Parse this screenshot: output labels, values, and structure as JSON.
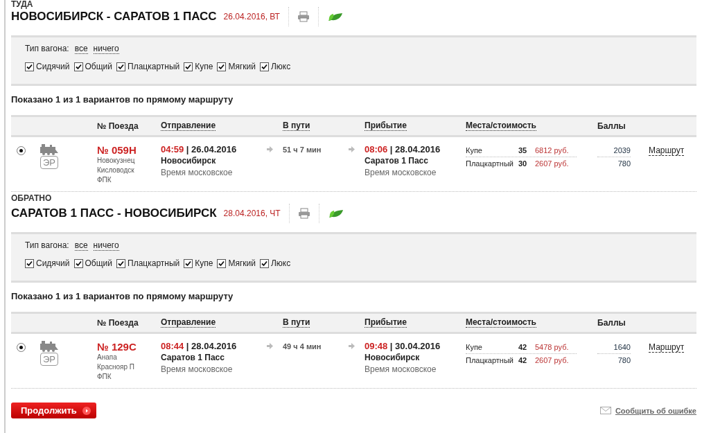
{
  "sections": [
    {
      "direction": "ТУДА",
      "route": "НОВОСИБИРСК - САРАТОВ 1 ПАСС",
      "date": "26.04.2016, ВТ",
      "filter": {
        "label": "Тип вагона:",
        "links": [
          "все",
          "ничего"
        ],
        "types": [
          {
            "label": "Сидячий",
            "checked": true
          },
          {
            "label": "Общий",
            "checked": true
          },
          {
            "label": "Плацкартный",
            "checked": true
          },
          {
            "label": "Купе",
            "checked": true
          },
          {
            "label": "Мягкий",
            "checked": true
          },
          {
            "label": "Люкс",
            "checked": true
          }
        ]
      },
      "summary": "Показано 1 из 1 вариантов по прямому маршруту",
      "columns": [
        {
          "label": "№ Поезда",
          "sortable": false
        },
        {
          "label": "Отправление",
          "sortable": true
        },
        {
          "label": "В пути",
          "sortable": true
        },
        {
          "label": "Прибытие",
          "sortable": true
        },
        {
          "label": "Места/стоимость",
          "sortable": true
        },
        {
          "label": "Баллы",
          "sortable": false
        }
      ],
      "trains": [
        {
          "selected": true,
          "badge": "ЭР",
          "number": "№ 059Н",
          "details": [
            "Новокузнец",
            "Кисловодск",
            "ФПК"
          ],
          "departure": {
            "time": "04:59",
            "date": "| 26.04.2016",
            "station": "Новосибирск",
            "note": "Время московское"
          },
          "duration": "51 ч 7 мин",
          "arrival": {
            "time": "08:06",
            "date": "| 28.04.2016",
            "station": "Саратов 1 Пасс",
            "note": "Время московское"
          },
          "seats": [
            {
              "type": "Купе",
              "count": "35",
              "price": "6812 руб.",
              "points": "2039"
            },
            {
              "type": "Плацкартный",
              "count": "30",
              "price": "2607 руб.",
              "points": "780"
            }
          ],
          "route_link": "Маршрут"
        }
      ]
    },
    {
      "direction": "ОБРАТНО",
      "route": "САРАТОВ 1 ПАСС - НОВОСИБИРСК",
      "date": "28.04.2016, ЧТ",
      "filter": {
        "label": "Тип вагона:",
        "links": [
          "все",
          "ничего"
        ],
        "types": [
          {
            "label": "Сидячий",
            "checked": true
          },
          {
            "label": "Общий",
            "checked": true
          },
          {
            "label": "Плацкартный",
            "checked": true
          },
          {
            "label": "Купе",
            "checked": true
          },
          {
            "label": "Мягкий",
            "checked": true
          },
          {
            "label": "Люкс",
            "checked": true
          }
        ]
      },
      "summary": "Показано 1 из 1 вариантов по прямому маршруту",
      "columns": [
        {
          "label": "№ Поезда",
          "sortable": false
        },
        {
          "label": "Отправление",
          "sortable": true
        },
        {
          "label": "В пути",
          "sortable": true
        },
        {
          "label": "Прибытие",
          "sortable": true
        },
        {
          "label": "Места/стоимость",
          "sortable": true
        },
        {
          "label": "Баллы",
          "sortable": false
        }
      ],
      "trains": [
        {
          "selected": true,
          "badge": "ЭР",
          "number": "№ 129С",
          "details": [
            "Анапа",
            "Краснояр П",
            "ФПК"
          ],
          "departure": {
            "time": "08:44",
            "date": "| 28.04.2016",
            "station": "Саратов 1 Пасс",
            "note": "Время московское"
          },
          "duration": "49 ч 4 мин",
          "arrival": {
            "time": "09:48",
            "date": "| 30.04.2016",
            "station": "Новосибирск",
            "note": "Время московское"
          },
          "seats": [
            {
              "type": "Купе",
              "count": "42",
              "price": "5478 руб.",
              "points": "1640"
            },
            {
              "type": "Плацкартный",
              "count": "42",
              "price": "2607 руб.",
              "points": "780"
            }
          ],
          "route_link": "Маршрут"
        }
      ]
    }
  ],
  "continue_button": "Продолжить",
  "report_link": "Сообщить об ошибке"
}
